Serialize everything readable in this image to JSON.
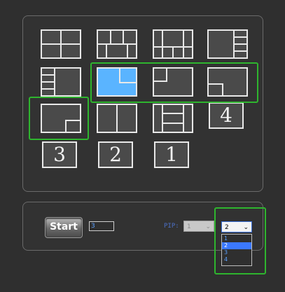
{
  "layout_grid": {
    "numbered_tiles": [
      "4",
      "3",
      "2",
      "1"
    ],
    "selected_layout": "pip-top-right",
    "colors": {
      "tile_fill": "#4a4a4a",
      "tile_border": "#e8e8e8",
      "selected_fill": "#5ab4ff",
      "highlight": "#2eb52e"
    }
  },
  "controls": {
    "start_label": "Start",
    "count_value": "3",
    "pip_label": "PIP:",
    "pip_value": "1",
    "sub_value": "2",
    "sub_options": [
      "1",
      "2",
      "3",
      "4"
    ],
    "sub_selected": "2",
    "dropdown_arrow": "chevron-down-icon"
  }
}
